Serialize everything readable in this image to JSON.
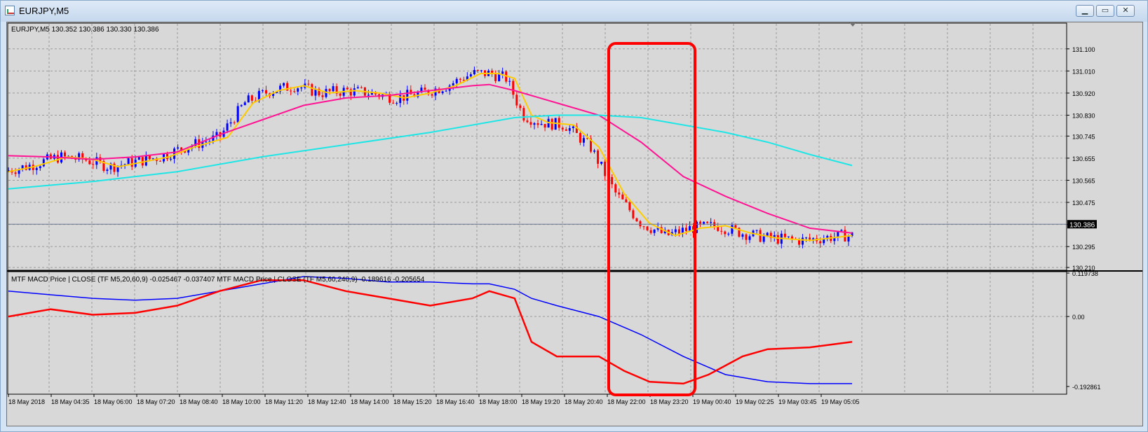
{
  "window": {
    "title": "EURJPY,M5",
    "minimize_label": "▁",
    "maximize_label": "▭",
    "close_label": "✕"
  },
  "main_chart": {
    "info": "EURJPY,M5  130.352 130.386 130.330 130.386",
    "current_price": "130.386",
    "price_labels": [
      "131.100",
      "131.010",
      "130.920",
      "130.830",
      "130.745",
      "130.655",
      "130.565",
      "130.475",
      "130.385",
      "130.295",
      "130.210"
    ]
  },
  "indicator": {
    "info": "MTF MACD Price | CLOSE  (TF M5,20,60,9) -0.025467 -0.037407  MTF MACD Price | CLOSE  (TF M5,60,240,9) -0.189616 -0.205654",
    "labels": [
      "0.119738",
      "0.00",
      "-0.192861"
    ]
  },
  "time_axis": [
    "18 May 2018",
    "18 May 04:35",
    "18 May 06:00",
    "18 May 07:20",
    "18 May 08:40",
    "18 May 10:00",
    "18 May 11:20",
    "18 May 12:40",
    "18 May 14:00",
    "18 May 15:20",
    "18 May 16:40",
    "18 May 18:00",
    "18 May 19:20",
    "18 May 20:40",
    "18 May 22:00",
    "18 May 23:20",
    "19 May 00:40",
    "19 May 02:25",
    "19 May 03:45",
    "19 May 05:05"
  ],
  "colors": {
    "background": "#d8d8d8",
    "grid": "#9a9a9a",
    "candle_up": "#0000ff",
    "candle_down": "#ff0000",
    "ma_fast": "#ffcc00",
    "ma_mid": "#ff1493",
    "ma_slow": "#1ee6e6",
    "macd_line": "#0000ff",
    "signal_line": "#ff0000",
    "highlight_box": "#ff0000"
  },
  "chart_data": {
    "type": "candlestick",
    "symbol": "EURJPY",
    "timeframe": "M5",
    "ylim": [
      130.21,
      131.145
    ],
    "overlays": [
      {
        "color": "ma_fast",
        "points": [
          [
            0,
            130.6
          ],
          [
            0.03,
            130.62
          ],
          [
            0.07,
            130.66
          ],
          [
            0.1,
            130.65
          ],
          [
            0.13,
            130.62
          ],
          [
            0.16,
            130.64
          ],
          [
            0.19,
            130.66
          ],
          [
            0.22,
            130.7
          ],
          [
            0.26,
            130.74
          ],
          [
            0.29,
            130.88
          ],
          [
            0.32,
            130.93
          ],
          [
            0.35,
            130.95
          ],
          [
            0.38,
            130.92
          ],
          [
            0.41,
            130.93
          ],
          [
            0.44,
            130.92
          ],
          [
            0.47,
            130.9
          ],
          [
            0.5,
            130.92
          ],
          [
            0.53,
            130.95
          ],
          [
            0.56,
            131.0
          ],
          [
            0.58,
            131.0
          ],
          [
            0.6,
            130.98
          ],
          [
            0.62,
            130.83
          ],
          [
            0.64,
            130.8
          ],
          [
            0.67,
            130.79
          ],
          [
            0.7,
            130.7
          ],
          [
            0.73,
            130.51
          ],
          [
            0.76,
            130.39
          ],
          [
            0.79,
            130.34
          ],
          [
            0.82,
            130.37
          ],
          [
            0.85,
            130.38
          ],
          [
            0.88,
            130.35
          ],
          [
            0.91,
            130.33
          ],
          [
            0.95,
            130.32
          ],
          [
            1.0,
            130.34
          ]
        ]
      },
      {
        "color": "ma_mid",
        "points": [
          [
            0,
            130.665
          ],
          [
            0.05,
            130.66
          ],
          [
            0.1,
            130.65
          ],
          [
            0.15,
            130.66
          ],
          [
            0.2,
            130.68
          ],
          [
            0.25,
            130.75
          ],
          [
            0.3,
            130.81
          ],
          [
            0.35,
            130.87
          ],
          [
            0.4,
            130.9
          ],
          [
            0.45,
            130.91
          ],
          [
            0.5,
            130.93
          ],
          [
            0.55,
            130.95
          ],
          [
            0.57,
            130.955
          ],
          [
            0.6,
            130.93
          ],
          [
            0.65,
            130.88
          ],
          [
            0.7,
            130.83
          ],
          [
            0.75,
            130.72
          ],
          [
            0.8,
            130.58
          ],
          [
            0.85,
            130.5
          ],
          [
            0.9,
            130.43
          ],
          [
            0.95,
            130.37
          ],
          [
            1.0,
            130.35
          ]
        ]
      },
      {
        "color": "ma_slow",
        "points": [
          [
            0,
            130.53
          ],
          [
            0.1,
            130.56
          ],
          [
            0.2,
            130.6
          ],
          [
            0.3,
            130.66
          ],
          [
            0.4,
            130.71
          ],
          [
            0.5,
            130.76
          ],
          [
            0.6,
            130.82
          ],
          [
            0.65,
            130.83
          ],
          [
            0.7,
            130.83
          ],
          [
            0.75,
            130.82
          ],
          [
            0.8,
            130.79
          ],
          [
            0.85,
            130.76
          ],
          [
            0.9,
            130.72
          ],
          [
            0.95,
            130.67
          ],
          [
            1.0,
            130.625
          ]
        ]
      }
    ],
    "macd": {
      "ylim": [
        -0.192861,
        0.119738
      ],
      "series": [
        {
          "color": "macd_line",
          "points": [
            [
              0,
              0.07
            ],
            [
              0.05,
              0.06
            ],
            [
              0.1,
              0.05
            ],
            [
              0.15,
              0.045
            ],
            [
              0.2,
              0.05
            ],
            [
              0.25,
              0.07
            ],
            [
              0.3,
              0.09
            ],
            [
              0.35,
              0.11
            ],
            [
              0.4,
              0.105
            ],
            [
              0.45,
              0.095
            ],
            [
              0.5,
              0.095
            ],
            [
              0.55,
              0.09
            ],
            [
              0.57,
              0.09
            ],
            [
              0.6,
              0.075
            ],
            [
              0.62,
              0.05
            ],
            [
              0.65,
              0.03
            ],
            [
              0.7,
              0.0
            ],
            [
              0.75,
              -0.05
            ],
            [
              0.8,
              -0.11
            ],
            [
              0.85,
              -0.16
            ],
            [
              0.9,
              -0.18
            ],
            [
              0.95,
              -0.185
            ],
            [
              1.0,
              -0.185
            ]
          ]
        },
        {
          "color": "signal_line",
          "points": [
            [
              0,
              0.0
            ],
            [
              0.05,
              0.02
            ],
            [
              0.1,
              0.005
            ],
            [
              0.15,
              0.01
            ],
            [
              0.2,
              0.03
            ],
            [
              0.25,
              0.07
            ],
            [
              0.3,
              0.1
            ],
            [
              0.35,
              0.1
            ],
            [
              0.4,
              0.07
            ],
            [
              0.45,
              0.05
            ],
            [
              0.5,
              0.03
            ],
            [
              0.55,
              0.05
            ],
            [
              0.57,
              0.07
            ],
            [
              0.6,
              0.05
            ],
            [
              0.62,
              -0.07
            ],
            [
              0.65,
              -0.11
            ],
            [
              0.7,
              -0.11
            ],
            [
              0.73,
              -0.15
            ],
            [
              0.76,
              -0.18
            ],
            [
              0.8,
              -0.185
            ],
            [
              0.83,
              -0.16
            ],
            [
              0.87,
              -0.11
            ],
            [
              0.9,
              -0.09
            ],
            [
              0.95,
              -0.085
            ],
            [
              1.0,
              -0.07
            ]
          ]
        }
      ]
    }
  }
}
